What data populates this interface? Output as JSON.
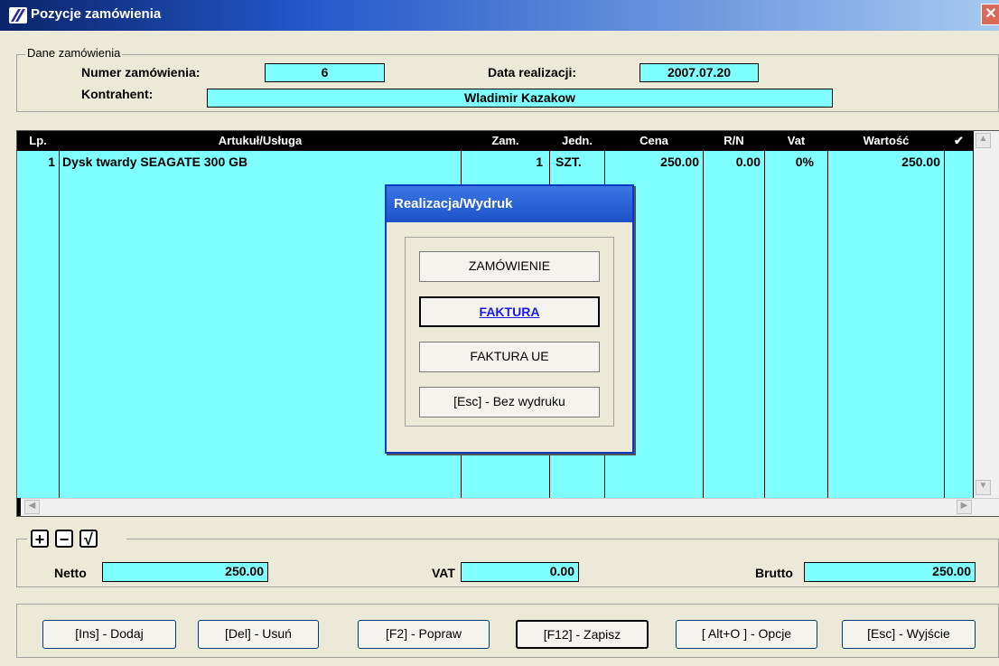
{
  "window": {
    "title": "Pozycje zamówienia",
    "close": "✕"
  },
  "order": {
    "group_label": "Dane zamówienia",
    "number_label": "Numer zamówienia:",
    "number_value": "6",
    "date_label": "Data realizacji:",
    "date_value": "2007.07.20",
    "client_label": "Kontrahent:",
    "client_value": "Wladimir Kazakow"
  },
  "table": {
    "headers": [
      "Lp.",
      "Artukuł/Usługa",
      "Zam.",
      "Jedn.",
      "Cena",
      "R/N",
      "Vat",
      "Wartość",
      "✔"
    ],
    "rows": [
      {
        "lp": "1",
        "item": "Dysk twardy SEAGATE 300 GB",
        "qty": "1",
        "unit": "SZT.",
        "price": "250.00",
        "rn": "0.00",
        "vat": "0%",
        "value": "250.00",
        "check": ""
      }
    ]
  },
  "toolbar_icons": [
    "plus-icon",
    "minus-icon",
    "check-icon"
  ],
  "totals": {
    "netto_label": "Netto",
    "netto_value": "250.00",
    "vat_label": "VAT",
    "vat_value": "0.00",
    "brutto_label": "Brutto",
    "brutto_value": "250.00"
  },
  "buttons": {
    "add": "[Ins] - Dodaj",
    "delete": "[Del] - Usuń",
    "edit": "[F2] - Popraw",
    "save": "[F12] - Zapisz",
    "options": "[ Alt+O ] - Opcje",
    "exit": "[Esc] - Wyjście"
  },
  "dialog": {
    "title": "Realizacja/Wydruk",
    "buttons": [
      "ZAMÓWIENIE",
      "FAKTURA",
      "FAKTURA UE",
      "[Esc] - Bez wydruku"
    ]
  },
  "colors": {
    "field": "#7fffff",
    "title_start": "#0a246a",
    "title_end": "#a6caf0",
    "dialog_title": "#1d5ad4"
  }
}
